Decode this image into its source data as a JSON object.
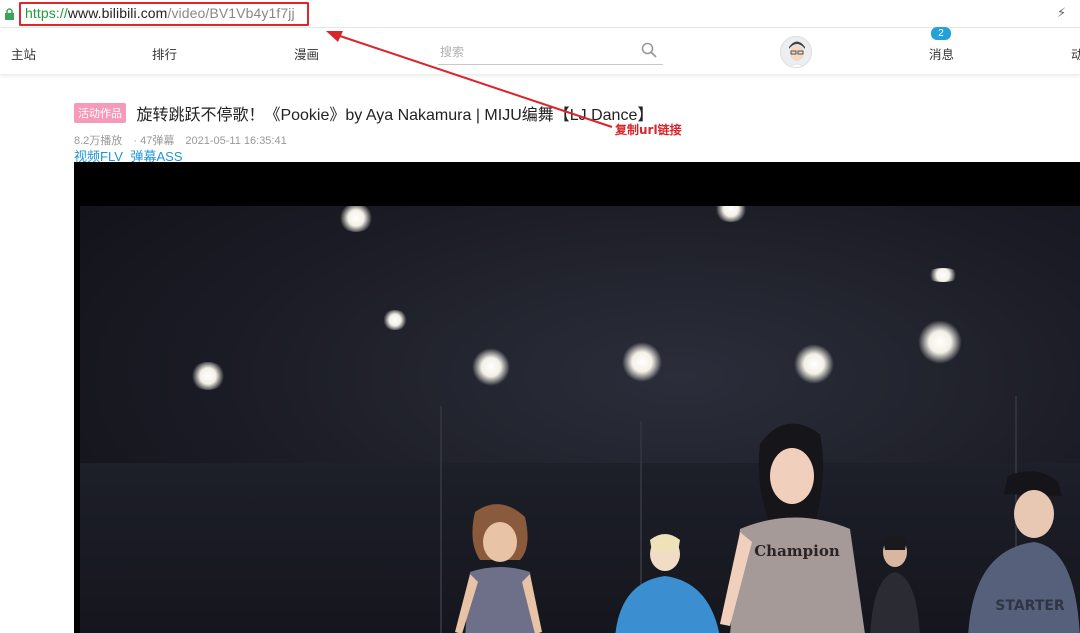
{
  "browser": {
    "url_scheme": "https://",
    "url_host": "www.bilibili.com",
    "url_path": "/video/BV1Vb4y1f7jj"
  },
  "nav": {
    "home": "主站",
    "ranking": "排行",
    "comics": "漫画",
    "search_placeholder": "搜索",
    "messages": "消息",
    "messages_badge": "2",
    "dynamic": "动"
  },
  "annotation": {
    "label": "复制url链接",
    "color": "#d8262b"
  },
  "video": {
    "tag": "活动作品",
    "title": "旋转跳跃不停歌！《Pookie》by Aya Nakamura | MIJU编舞【LJ Dance】",
    "views": "8.2万播放",
    "danmaku": "· 47弹幕",
    "date": "2021-05-11 16:35:41",
    "link_flv": "视频FLV",
    "link_ass": "弹幕ASS",
    "shirt_text": "Champion",
    "shirt_text_2": "STARTER"
  },
  "colors": {
    "accent": "#23a2d8",
    "tag_pink": "#f59ab8",
    "link_blue": "#1c97d6",
    "url_green": "#1f9d3a"
  }
}
